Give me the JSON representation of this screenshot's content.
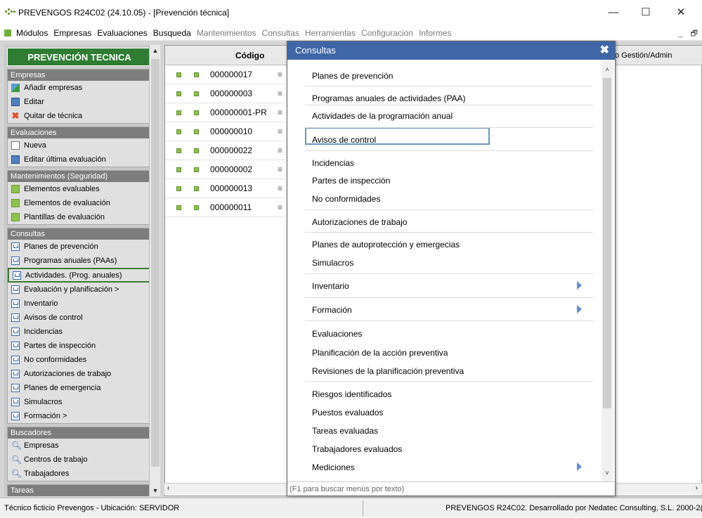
{
  "window": {
    "title": "PREVENGOS R24C02 (24.10.05) - [Prevención técnica]",
    "minimize": "—",
    "maximize": "☐",
    "close": "✕"
  },
  "menubar": {
    "items": [
      {
        "label": "Módulos",
        "enabled": true
      },
      {
        "label": "Empresas",
        "enabled": true
      },
      {
        "label": "Evaluaciones",
        "enabled": true
      },
      {
        "label": "Busqueda",
        "enabled": true
      },
      {
        "label": "Mantenimientos",
        "enabled": false
      },
      {
        "label": "Consultas",
        "enabled": false
      },
      {
        "label": "Herramientas",
        "enabled": false
      },
      {
        "label": "Configuración",
        "enabled": false
      },
      {
        "label": "Informes",
        "enabled": false
      }
    ],
    "mdi_min": "_",
    "mdi_restore": "🗗"
  },
  "sidebar": {
    "header": "PREVENCIÓN TECNICA",
    "groups": [
      {
        "title": "Empresas",
        "items": [
          {
            "label": "Añadir empresas",
            "icon": "add-icon"
          },
          {
            "label": "Editar",
            "icon": "edit-icon"
          },
          {
            "label": "Quitar de técnica",
            "icon": "remove-icon"
          }
        ]
      },
      {
        "title": "Evaluaciones",
        "items": [
          {
            "label": "Nueva",
            "icon": "document-icon"
          },
          {
            "label": "Editar última evaluación",
            "icon": "edit-icon"
          }
        ]
      },
      {
        "title": "Mantenimientos (Seguridad)",
        "items": [
          {
            "label": "Elementos evaluables",
            "icon": "square-icon"
          },
          {
            "label": "Elementos de evaluación",
            "icon": "square-icon"
          },
          {
            "label": "Plantillas de evaluación",
            "icon": "square-icon"
          }
        ]
      },
      {
        "title": "Consultas",
        "items": [
          {
            "label": "Planes de prevención",
            "icon": "query-icon"
          },
          {
            "label": "Programas anuales (PAAs)",
            "icon": "query-icon"
          },
          {
            "label": "Actividades. (Prog. anuales)",
            "icon": "query-icon",
            "selected": true
          },
          {
            "label": "Evaluación y planificación  >",
            "icon": "query-icon"
          },
          {
            "label": "Inventario",
            "icon": "query-icon"
          },
          {
            "label": "Avisos de control",
            "icon": "query-icon"
          },
          {
            "label": "Incidencias",
            "icon": "query-icon"
          },
          {
            "label": "Partes de inspección",
            "icon": "query-icon"
          },
          {
            "label": "No conformidades",
            "icon": "query-icon"
          },
          {
            "label": "Autorizaciones de trabajo",
            "icon": "query-icon"
          },
          {
            "label": "Planes de emergencia",
            "icon": "query-icon"
          },
          {
            "label": "Simulacros",
            "icon": "query-icon"
          },
          {
            "label": "Formación  >",
            "icon": "query-icon"
          }
        ]
      },
      {
        "title": "Buscadores",
        "items": [
          {
            "label": "Empresas",
            "icon": "magnifier-icon"
          },
          {
            "label": "Centros de trabajo",
            "icon": "magnifier-icon"
          },
          {
            "label": "Trabajadores",
            "icon": "magnifier-icon"
          }
        ]
      },
      {
        "title": "Tareas",
        "items": []
      }
    ]
  },
  "grid": {
    "code_header": "Código",
    "right_header": "o Gestión/Admin",
    "rows": [
      {
        "code": "000000017"
      },
      {
        "code": "000000003"
      },
      {
        "code": "000000001-PR"
      },
      {
        "code": "000000010"
      },
      {
        "code": "000000022"
      },
      {
        "code": "000000002"
      },
      {
        "code": "000000013"
      },
      {
        "code": "000000011"
      }
    ]
  },
  "popup": {
    "title": "Consultas",
    "items": [
      {
        "label": "Planes de prevención"
      },
      {
        "label": "Programas anuales de actividades (PAA)"
      },
      {
        "label": "Actividades de la programación anual",
        "highlighted": true
      },
      {
        "label": "Avisos de control"
      },
      {
        "label": "Incidencias"
      },
      {
        "label": "Partes de inspección"
      },
      {
        "label": "No conformidades"
      },
      {
        "label": "Autorizaciones de trabajo"
      },
      {
        "label": "Planes de autoprotección y emergecias"
      },
      {
        "label": "Simulacros"
      },
      {
        "label": "Inventario",
        "submenu": true
      },
      {
        "label": "Formación",
        "submenu": true
      },
      {
        "label": "Evaluaciones"
      },
      {
        "label": "Planificación de la acción preventiva"
      },
      {
        "label": "Revisiones de la planificación preventiva"
      },
      {
        "label": "Riesgos identificados"
      },
      {
        "label": "Puestos evaluados"
      },
      {
        "label": "Tareas evaluadas"
      },
      {
        "label": "Trabajadores evaluados"
      },
      {
        "label": "Mediciones",
        "submenu": true
      }
    ],
    "footer": "(F1 para buscar menús por texto)"
  },
  "statusbar": {
    "left": "Técnico ficticio Prevengos  -  Ubicación: SERVIDOR",
    "right": "PREVENGOS R24C02. Desarrollado por Nedatec Consulting, S.L. 2000-2("
  }
}
